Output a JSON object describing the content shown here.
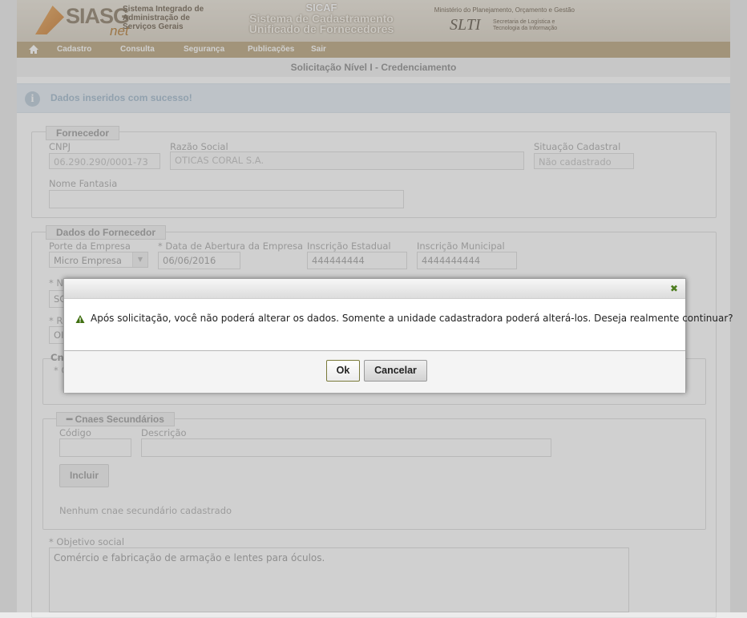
{
  "banner": {
    "logo_text": "SIASG",
    "logo_suffix": "net",
    "system_name": "Sistema Integrado de Administração de Serviços Gerais",
    "app_title": "SICAF",
    "app_subtitle_1": "Sistema de Cadastramento",
    "app_subtitle_2": "Unificado de Fornecedores",
    "ministry": "Ministério do Planejamento, Orçamento e Gestão",
    "slti_logo": "SLTI",
    "slti_text": "Secretaria de Logística e Tecnologia da Informação"
  },
  "menu": {
    "items": [
      "Cadastro",
      "Consulta",
      "Segurança",
      "Publicações",
      "Sair"
    ]
  },
  "page_title": "Solicitação Nível I - Credenciamento",
  "info_message": "Dados inseridos com sucesso!",
  "fornecedor": {
    "legend": "Fornecedor",
    "cnpj_label": "CNPJ",
    "cnpj_value": "06.290.290/0001-73",
    "razao_label": "Razão Social",
    "razao_value": "OTICAS CORAL S.A.",
    "situacao_label": "Situação Cadastral",
    "situacao_value": "Não cadastrado",
    "fantasia_label": "Nome Fantasia",
    "fantasia_value": ""
  },
  "dados": {
    "legend": "Dados do Fornecedor",
    "porte_label": "Porte da Empresa",
    "porte_value": "Micro Empresa",
    "abertura_label": "* Data de Abertura da Empresa",
    "abertura_value": "06/06/2016",
    "estadual_label": "Inscrição Estadual",
    "estadual_value": "444444444",
    "municipal_label": "Inscrição Municipal",
    "municipal_value": "4444444444",
    "partial_1": "* N",
    "partial_1_val": "SC",
    "partial_2": "* R",
    "partial_2_val": "OI",
    "partial_3": "Cn",
    "partial_4": "* C"
  },
  "cnaes": {
    "legend": "Cnaes Secundários",
    "codigo_label": "Código",
    "descricao_label": "Descrição",
    "incluir_label": "Incluir",
    "empty_note": "Nenhum cnae secundário cadastrado"
  },
  "objetivo": {
    "label": "* Objetivo social",
    "value": "Comércio e fabricação de armação e lentes para óculos."
  },
  "dialog": {
    "message": "Após solicitação, você não poderá alterar os dados. Somente a unidade cadastradora poderá alterá-los. Deseja realmente continuar?",
    "ok_label": "Ok",
    "cancel_label": "Cancelar",
    "close_glyph": "✖"
  },
  "colors": {
    "menubar": "#b8a47b",
    "info_bg": "#e4ecf3",
    "ok_border": "#7a7a3a",
    "close_icon": "#4d7d1f"
  }
}
